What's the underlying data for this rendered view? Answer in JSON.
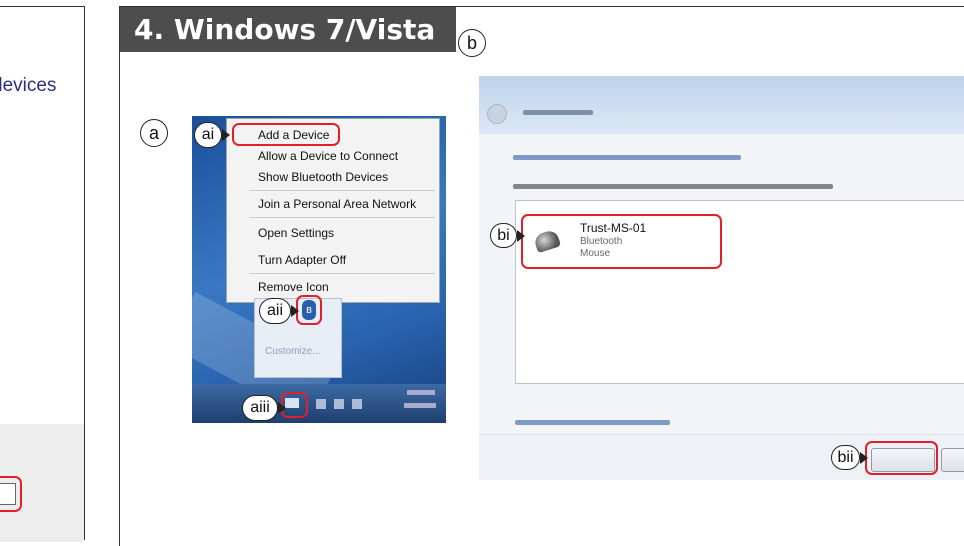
{
  "left_panel": {
    "text_fragment": "devices"
  },
  "header": {
    "title": "4. Windows 7/Vista"
  },
  "labels": {
    "a": "a",
    "b": "b",
    "ai": "ai",
    "aii": "aii",
    "aiii": "aiii",
    "bi": "bi",
    "bii": "bii"
  },
  "context_menu": {
    "items": [
      "Add a Device",
      "Allow a Device to Connect",
      "Show Bluetooth Devices",
      "Join a Personal Area Network",
      "Open Settings",
      "Turn Adapter Off",
      "Remove Icon"
    ],
    "customize_label": "Customize..."
  },
  "add_device_dialog": {
    "device_name": "Trust-MS-01",
    "device_type": "Bluetooth",
    "device_kind": "Mouse"
  },
  "colors": {
    "title_bar": "#4d4d4d",
    "highlight": "#e0202a",
    "taskbar": "#2a5a95"
  },
  "icons": [
    "bluetooth-icon",
    "mouse-icon",
    "back-arrow-icon"
  ]
}
